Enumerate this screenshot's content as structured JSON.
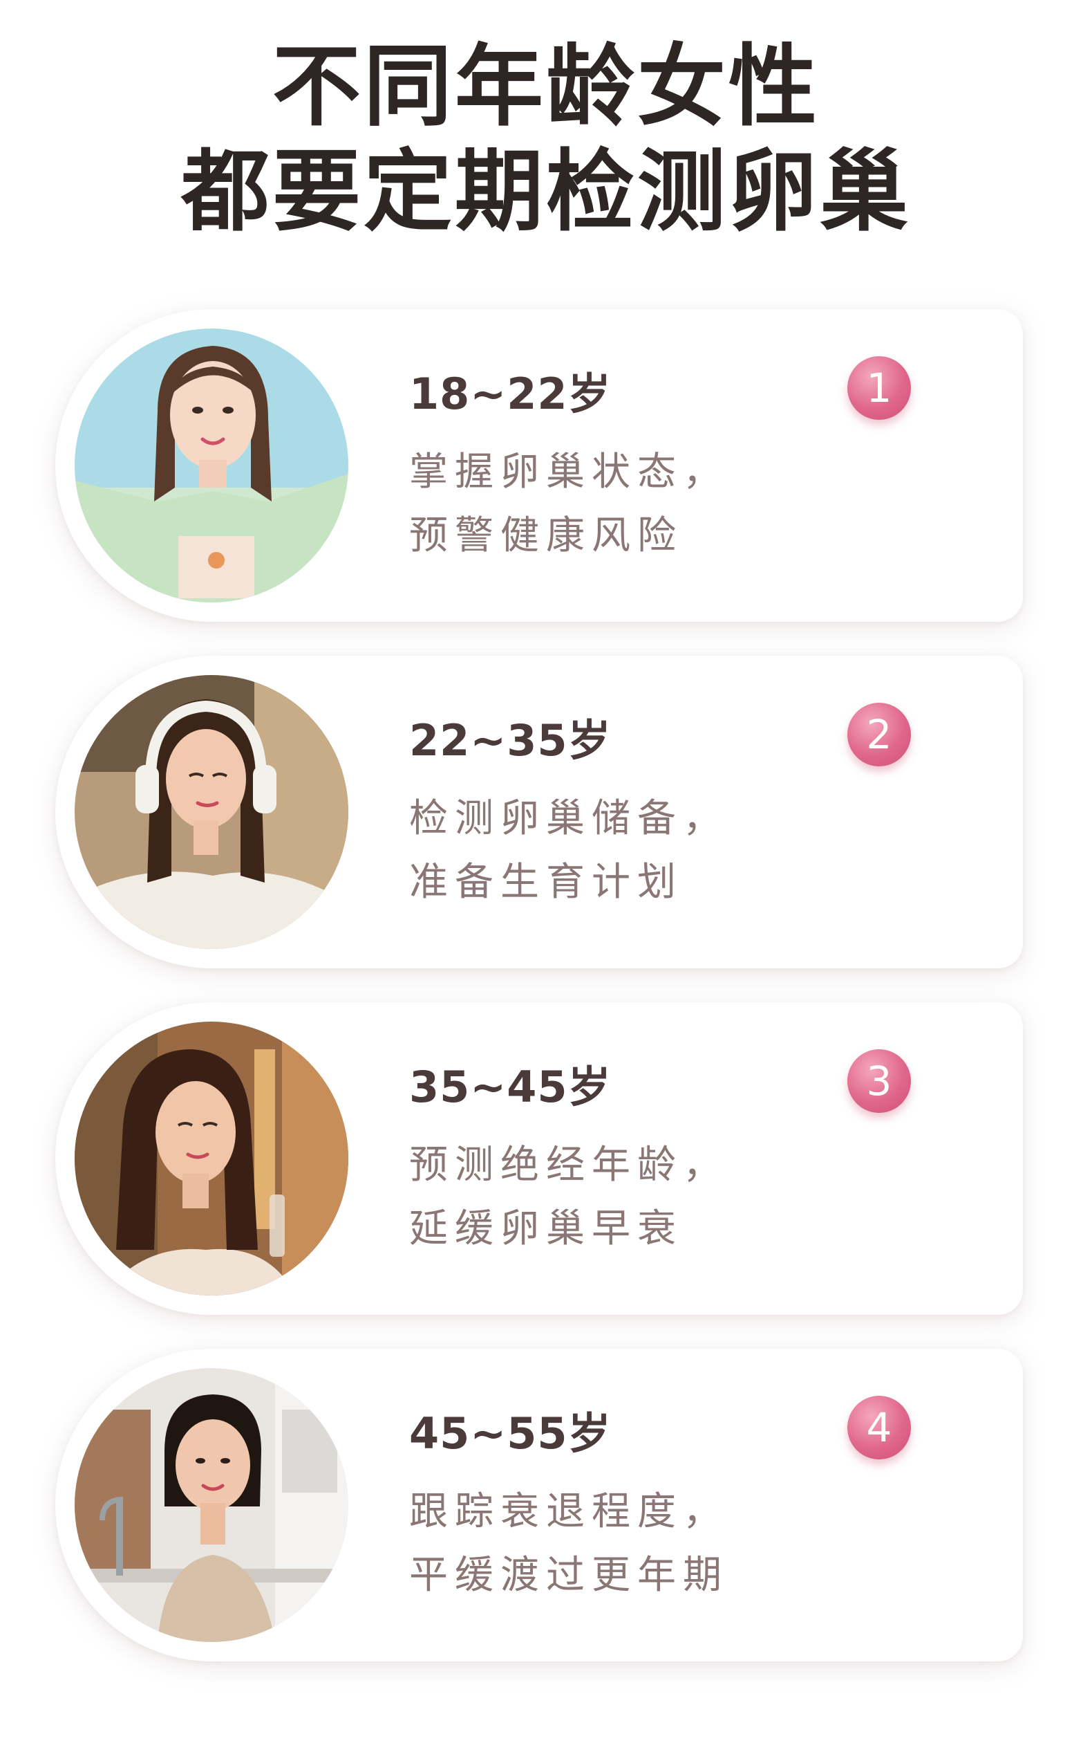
{
  "heading": {
    "line1": "不同年龄女性",
    "line2": "都要定期检测卵巢"
  },
  "cards": [
    {
      "number": "1",
      "age": "18~22岁",
      "line1": "掌握卵巢状态，",
      "line2": "预警健康风险"
    },
    {
      "number": "2",
      "age": "22~35岁",
      "line1": "检测卵巢储备，",
      "line2": "准备生育计划"
    },
    {
      "number": "3",
      "age": "35~45岁",
      "line1": "预测绝经年龄，",
      "line2": "延缓卵巢早衰"
    },
    {
      "number": "4",
      "age": "45~55岁",
      "line1": "跟踪衰退程度，",
      "line2": "平缓渡过更年期"
    }
  ],
  "colors": {
    "title": "#2e2625",
    "age": "#4a3a39",
    "description": "#8a7674",
    "badge": "#e0678c"
  }
}
